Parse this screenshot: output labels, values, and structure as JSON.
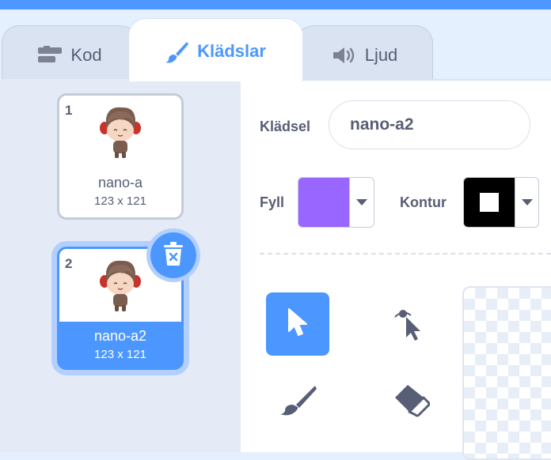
{
  "tabs": {
    "code": {
      "label": "Kod",
      "icon": "code-blocks-icon"
    },
    "costumes": {
      "label": "Klädslar",
      "icon": "paintbrush-icon"
    },
    "sound": {
      "label": "Ljud",
      "icon": "speaker-icon"
    }
  },
  "costumes": [
    {
      "number": "1",
      "name": "nano-a",
      "size": "123 x 121",
      "selected": false
    },
    {
      "number": "2",
      "name": "nano-a2",
      "size": "123 x 121",
      "selected": true
    }
  ],
  "editor": {
    "costume_label": "Klädsel",
    "costume_name": "nano-a2",
    "fill_label": "Fyll",
    "fill_color": "#9966ff",
    "outline_label": "Kontur",
    "outline_color": "#000000"
  },
  "tools": [
    {
      "name": "select",
      "icon": "arrow-select-icon",
      "active": true
    },
    {
      "name": "reshape",
      "icon": "reshape-icon",
      "active": false
    },
    {
      "name": "brush",
      "icon": "brush-icon",
      "active": false
    },
    {
      "name": "eraser",
      "icon": "eraser-icon",
      "active": false
    }
  ],
  "colors": {
    "accent": "#4c97ff",
    "text": "#575e75",
    "panel": "#e4ebf6"
  }
}
